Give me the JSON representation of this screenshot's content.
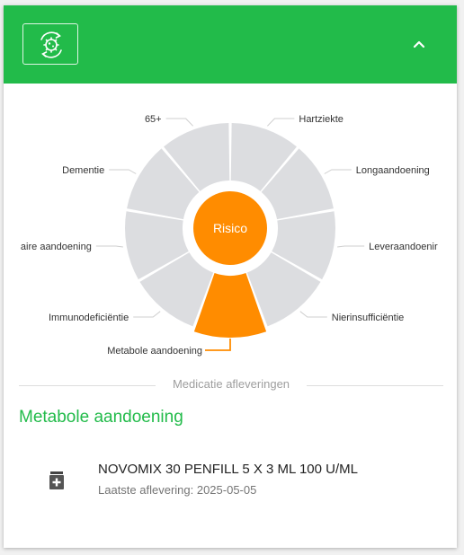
{
  "header": {
    "icon": "virus-cycle-icon",
    "collapse_icon": "chevron-up-icon",
    "background": "#22bb4a"
  },
  "wheel": {
    "center_label": "Risico",
    "active_color": "#ff8c00",
    "inactive_color": "#dcdde0",
    "segments": [
      {
        "label": "Hartziekte",
        "active": false
      },
      {
        "label": "Longaandoening",
        "active": false
      },
      {
        "label": "Leveraandoenir",
        "active": false
      },
      {
        "label": "Nierinsufficiëntie",
        "active": false
      },
      {
        "label": "Metabole aandoening",
        "active": true
      },
      {
        "label": "Immunodeficiëntie",
        "active": false
      },
      {
        "label": "aire aandoening",
        "active": false
      },
      {
        "label": "Dementie",
        "active": false
      },
      {
        "label": "65+",
        "active": false
      }
    ]
  },
  "divider": {
    "label": "Medicatie afleveringen"
  },
  "section": {
    "title": "Metabole aandoening"
  },
  "medications": [
    {
      "icon": "medicine-icon",
      "name": "NOVOMIX 30 PENFILL 5 X 3 ML 100 U/ML",
      "last_delivery": "Laatste aflevering: 2025-05-05"
    }
  ]
}
